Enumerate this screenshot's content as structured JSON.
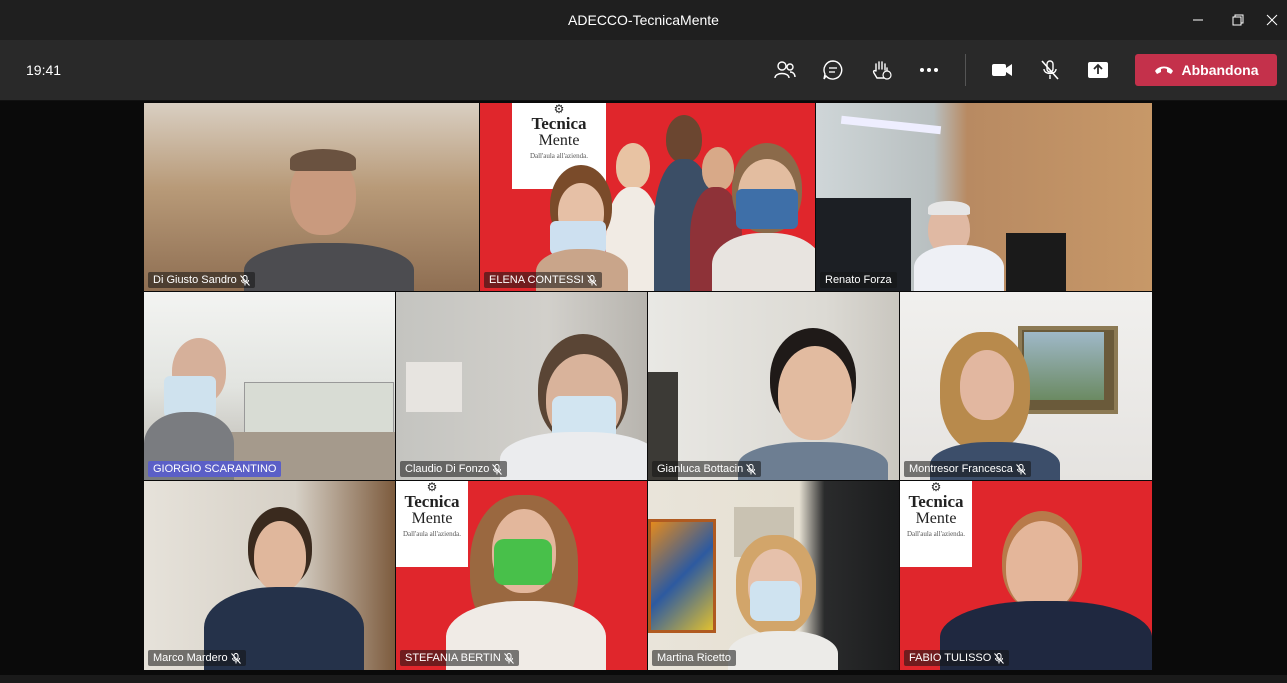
{
  "window": {
    "title": "ADECCO-TecnicaMente"
  },
  "toolbar": {
    "time": "19:41",
    "leave_label": "Abbandona"
  },
  "brand": {
    "line1": "Tecnica",
    "line2": "Mente",
    "tagline": "Dall'aula all'azienda."
  },
  "participants": [
    {
      "name": "Di Giusto Sandro",
      "muted": true,
      "active": false
    },
    {
      "name": "ELENA CONTESSI",
      "muted": true,
      "active": false
    },
    {
      "name": "Renato Forza",
      "muted": false,
      "active": false
    },
    {
      "name": "GIORGIO SCARANTINO",
      "muted": false,
      "active": true
    },
    {
      "name": "Claudio Di Fonzo",
      "muted": true,
      "active": false
    },
    {
      "name": "Gianluca Bottacin",
      "muted": true,
      "active": false
    },
    {
      "name": "Montresor Francesca",
      "muted": true,
      "active": false
    },
    {
      "name": "Marco Mardero",
      "muted": true,
      "active": false
    },
    {
      "name": "STEFANIA BERTIN",
      "muted": true,
      "active": false
    },
    {
      "name": "Martina  Ricetto",
      "muted": false,
      "active": false
    },
    {
      "name": "FABIO TULISSO",
      "muted": true,
      "active": false
    }
  ],
  "colors": {
    "leave": "#c4314b",
    "active_speaker": "#5b5fc7",
    "brand_red": "#e0262c"
  }
}
